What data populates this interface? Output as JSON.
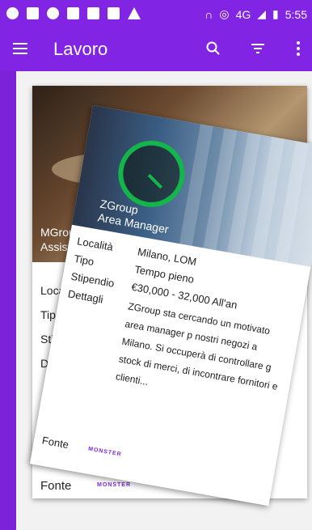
{
  "status_bar": {
    "time": "5:55",
    "network": "4G"
  },
  "app_bar": {
    "title": "Lavoro"
  },
  "cards": [
    {
      "company_role": "MGroup\nAssistente alla v",
      "labels": [
        "Località",
        "Tipo",
        "Stipendio",
        "Dettagli"
      ],
      "fonte": "Fonte",
      "source_logo": "MONSTER"
    },
    {
      "company_role": "ZGroup\nArea Manager",
      "labels": [
        "Località",
        "Tipo",
        "Stipendio",
        "Dettagli"
      ],
      "values": {
        "location": "Milano, LOM",
        "type": "Tempo pieno",
        "salary": "€30,000 - 32,000 All'an",
        "details": "ZGroup sta cercando un motivato area manager p nostri negozi a Milano. Si occuperà di controllare g stock di merci, di incontrare fornitori e clienti..."
      },
      "fonte": "Fonte",
      "source_logo": "MONSTER"
    }
  ],
  "colors": {
    "primary": "#8224e3",
    "accent": "#14b54a",
    "logo": "#7b2bd9"
  }
}
